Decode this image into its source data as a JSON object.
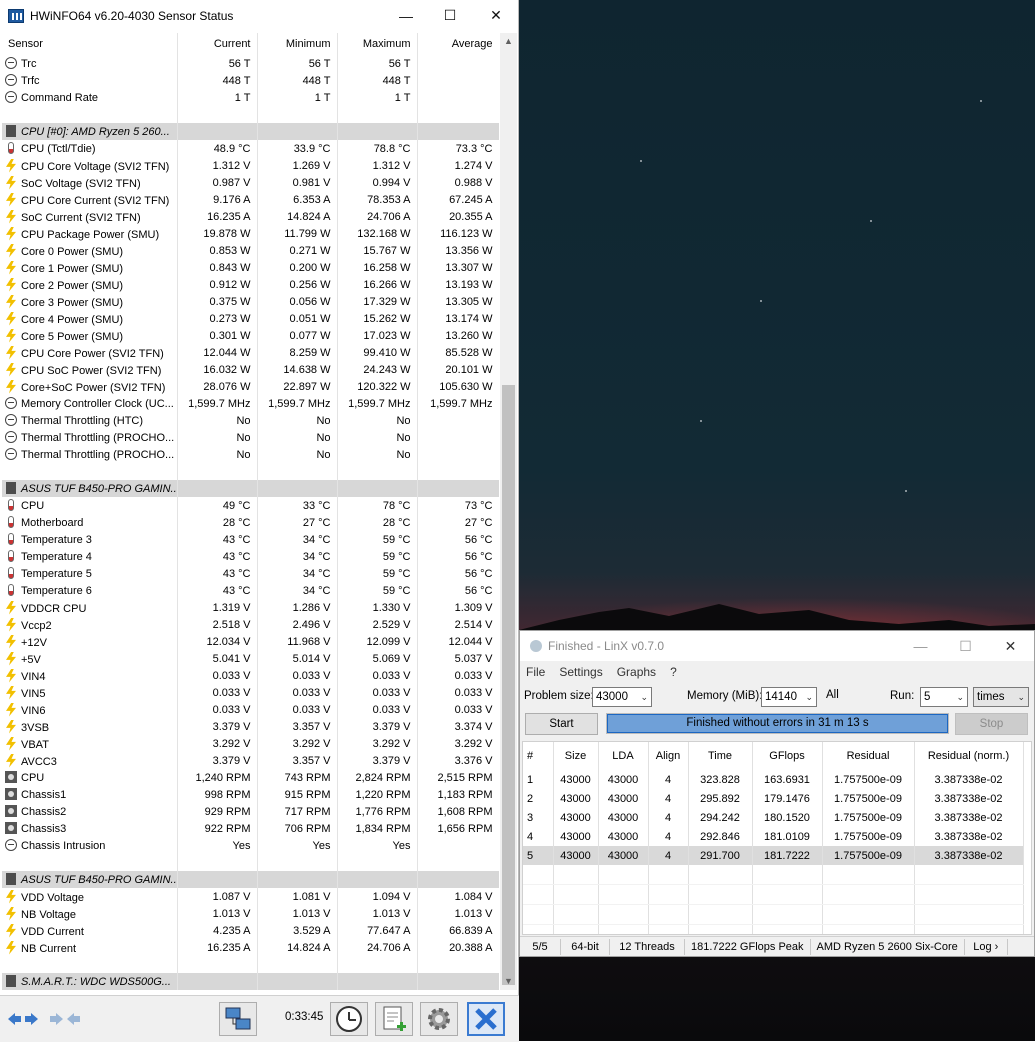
{
  "hwinfo": {
    "title": "HWiNFO64 v6.20-4030 Sensor Status",
    "columns": [
      "Sensor",
      "Current",
      "Minimum",
      "Maximum",
      "Average"
    ],
    "rows": [
      {
        "type": "row",
        "icon": "dash",
        "name": "Trc",
        "cur": "56 T",
        "min": "56 T",
        "max": "56 T",
        "avg": ""
      },
      {
        "type": "row",
        "icon": "dash",
        "name": "Trfc",
        "cur": "448 T",
        "min": "448 T",
        "max": "448 T",
        "avg": ""
      },
      {
        "type": "row",
        "icon": "dash",
        "name": "Command Rate",
        "cur": "1 T",
        "min": "1 T",
        "max": "1 T",
        "avg": ""
      },
      {
        "type": "blank"
      },
      {
        "type": "group",
        "name": "CPU [#0]: AMD Ryzen 5 260..."
      },
      {
        "type": "row",
        "icon": "temp",
        "name": "CPU (Tctl/Tdie)",
        "cur": "48.9 °C",
        "min": "33.9 °C",
        "max": "78.8 °C",
        "avg": "73.3 °C"
      },
      {
        "type": "row",
        "icon": "volt",
        "name": "CPU Core Voltage (SVI2 TFN)",
        "cur": "1.312 V",
        "min": "1.269 V",
        "max": "1.312 V",
        "avg": "1.274 V"
      },
      {
        "type": "row",
        "icon": "volt",
        "name": "SoC Voltage (SVI2 TFN)",
        "cur": "0.987 V",
        "min": "0.981 V",
        "max": "0.994 V",
        "avg": "0.988 V"
      },
      {
        "type": "row",
        "icon": "volt",
        "name": "CPU Core Current (SVI2 TFN)",
        "cur": "9.176 A",
        "min": "6.353 A",
        "max": "78.353 A",
        "avg": "67.245 A"
      },
      {
        "type": "row",
        "icon": "volt",
        "name": "SoC Current (SVI2 TFN)",
        "cur": "16.235 A",
        "min": "14.824 A",
        "max": "24.706 A",
        "avg": "20.355 A"
      },
      {
        "type": "row",
        "icon": "volt",
        "name": "CPU Package Power (SMU)",
        "cur": "19.878 W",
        "min": "11.799 W",
        "max": "132.168 W",
        "avg": "116.123 W"
      },
      {
        "type": "row",
        "icon": "volt",
        "name": "Core 0 Power (SMU)",
        "cur": "0.853 W",
        "min": "0.271 W",
        "max": "15.767 W",
        "avg": "13.356 W"
      },
      {
        "type": "row",
        "icon": "volt",
        "name": "Core 1 Power (SMU)",
        "cur": "0.843 W",
        "min": "0.200 W",
        "max": "16.258 W",
        "avg": "13.307 W"
      },
      {
        "type": "row",
        "icon": "volt",
        "name": "Core 2 Power (SMU)",
        "cur": "0.912 W",
        "min": "0.256 W",
        "max": "16.266 W",
        "avg": "13.193 W"
      },
      {
        "type": "row",
        "icon": "volt",
        "name": "Core 3 Power (SMU)",
        "cur": "0.375 W",
        "min": "0.056 W",
        "max": "17.329 W",
        "avg": "13.305 W"
      },
      {
        "type": "row",
        "icon": "volt",
        "name": "Core 4 Power (SMU)",
        "cur": "0.273 W",
        "min": "0.051 W",
        "max": "15.262 W",
        "avg": "13.174 W"
      },
      {
        "type": "row",
        "icon": "volt",
        "name": "Core 5 Power (SMU)",
        "cur": "0.301 W",
        "min": "0.077 W",
        "max": "17.023 W",
        "avg": "13.260 W"
      },
      {
        "type": "row",
        "icon": "volt",
        "name": "CPU Core Power (SVI2 TFN)",
        "cur": "12.044 W",
        "min": "8.259 W",
        "max": "99.410 W",
        "avg": "85.528 W"
      },
      {
        "type": "row",
        "icon": "volt",
        "name": "CPU SoC Power (SVI2 TFN)",
        "cur": "16.032 W",
        "min": "14.638 W",
        "max": "24.243 W",
        "avg": "20.101 W"
      },
      {
        "type": "row",
        "icon": "volt",
        "name": "Core+SoC Power (SVI2 TFN)",
        "cur": "28.076 W",
        "min": "22.897 W",
        "max": "120.322 W",
        "avg": "105.630 W"
      },
      {
        "type": "row",
        "icon": "dash",
        "name": "Memory Controller Clock (UC...",
        "cur": "1,599.7 MHz",
        "min": "1,599.7 MHz",
        "max": "1,599.7 MHz",
        "avg": "1,599.7 MHz"
      },
      {
        "type": "row",
        "icon": "dash",
        "name": "Thermal Throttling (HTC)",
        "cur": "No",
        "min": "No",
        "max": "No",
        "avg": ""
      },
      {
        "type": "row",
        "icon": "dash",
        "name": "Thermal Throttling (PROCHO...",
        "cur": "No",
        "min": "No",
        "max": "No",
        "avg": ""
      },
      {
        "type": "row",
        "icon": "dash",
        "name": "Thermal Throttling (PROCHO...",
        "cur": "No",
        "min": "No",
        "max": "No",
        "avg": ""
      },
      {
        "type": "blank"
      },
      {
        "type": "group",
        "name": "ASUS TUF B450-PRO GAMIN..."
      },
      {
        "type": "row",
        "icon": "temp",
        "name": "CPU",
        "cur": "49 °C",
        "min": "33 °C",
        "max": "78 °C",
        "avg": "73 °C"
      },
      {
        "type": "row",
        "icon": "temp",
        "name": "Motherboard",
        "cur": "28 °C",
        "min": "27 °C",
        "max": "28 °C",
        "avg": "27 °C"
      },
      {
        "type": "row",
        "icon": "temp",
        "name": "Temperature 3",
        "cur": "43 °C",
        "min": "34 °C",
        "max": "59 °C",
        "avg": "56 °C"
      },
      {
        "type": "row",
        "icon": "temp",
        "name": "Temperature 4",
        "cur": "43 °C",
        "min": "34 °C",
        "max": "59 °C",
        "avg": "56 °C"
      },
      {
        "type": "row",
        "icon": "temp",
        "name": "Temperature 5",
        "cur": "43 °C",
        "min": "34 °C",
        "max": "59 °C",
        "avg": "56 °C"
      },
      {
        "type": "row",
        "icon": "temp",
        "name": "Temperature 6",
        "cur": "43 °C",
        "min": "34 °C",
        "max": "59 °C",
        "avg": "56 °C"
      },
      {
        "type": "row",
        "icon": "volt",
        "name": "VDDCR CPU",
        "cur": "1.319 V",
        "min": "1.286 V",
        "max": "1.330 V",
        "avg": "1.309 V"
      },
      {
        "type": "row",
        "icon": "volt",
        "name": "Vccp2",
        "cur": "2.518 V",
        "min": "2.496 V",
        "max": "2.529 V",
        "avg": "2.514 V"
      },
      {
        "type": "row",
        "icon": "volt",
        "name": "+12V",
        "cur": "12.034 V",
        "min": "11.968 V",
        "max": "12.099 V",
        "avg": "12.044 V"
      },
      {
        "type": "row",
        "icon": "volt",
        "name": "+5V",
        "cur": "5.041 V",
        "min": "5.014 V",
        "max": "5.069 V",
        "avg": "5.037 V"
      },
      {
        "type": "row",
        "icon": "volt",
        "name": "VIN4",
        "cur": "0.033 V",
        "min": "0.033 V",
        "max": "0.033 V",
        "avg": "0.033 V"
      },
      {
        "type": "row",
        "icon": "volt",
        "name": "VIN5",
        "cur": "0.033 V",
        "min": "0.033 V",
        "max": "0.033 V",
        "avg": "0.033 V"
      },
      {
        "type": "row",
        "icon": "volt",
        "name": "VIN6",
        "cur": "0.033 V",
        "min": "0.033 V",
        "max": "0.033 V",
        "avg": "0.033 V"
      },
      {
        "type": "row",
        "icon": "volt",
        "name": "3VSB",
        "cur": "3.379 V",
        "min": "3.357 V",
        "max": "3.379 V",
        "avg": "3.374 V"
      },
      {
        "type": "row",
        "icon": "volt",
        "name": "VBAT",
        "cur": "3.292 V",
        "min": "3.292 V",
        "max": "3.292 V",
        "avg": "3.292 V"
      },
      {
        "type": "row",
        "icon": "volt",
        "name": "AVCC3",
        "cur": "3.379 V",
        "min": "3.357 V",
        "max": "3.379 V",
        "avg": "3.376 V"
      },
      {
        "type": "row",
        "icon": "fan",
        "name": "CPU",
        "cur": "1,240 RPM",
        "min": "743 RPM",
        "max": "2,824 RPM",
        "avg": "2,515 RPM"
      },
      {
        "type": "row",
        "icon": "fan",
        "name": "Chassis1",
        "cur": "998 RPM",
        "min": "915 RPM",
        "max": "1,220 RPM",
        "avg": "1,183 RPM"
      },
      {
        "type": "row",
        "icon": "fan",
        "name": "Chassis2",
        "cur": "929 RPM",
        "min": "717 RPM",
        "max": "1,776 RPM",
        "avg": "1,608 RPM"
      },
      {
        "type": "row",
        "icon": "fan",
        "name": "Chassis3",
        "cur": "922 RPM",
        "min": "706 RPM",
        "max": "1,834 RPM",
        "avg": "1,656 RPM"
      },
      {
        "type": "row",
        "icon": "dash",
        "name": "Chassis Intrusion",
        "cur": "Yes",
        "min": "Yes",
        "max": "Yes",
        "avg": ""
      },
      {
        "type": "blank"
      },
      {
        "type": "group",
        "name": "ASUS TUF B450-PRO GAMIN..."
      },
      {
        "type": "row",
        "icon": "volt",
        "name": "VDD Voltage",
        "cur": "1.087 V",
        "min": "1.081 V",
        "max": "1.094 V",
        "avg": "1.084 V"
      },
      {
        "type": "row",
        "icon": "volt",
        "name": "NB Voltage",
        "cur": "1.013 V",
        "min": "1.013 V",
        "max": "1.013 V",
        "avg": "1.013 V"
      },
      {
        "type": "row",
        "icon": "volt",
        "name": "VDD Current",
        "cur": "4.235 A",
        "min": "3.529 A",
        "max": "77.647 A",
        "avg": "66.839 A"
      },
      {
        "type": "row",
        "icon": "volt",
        "name": "NB Current",
        "cur": "16.235 A",
        "min": "14.824 A",
        "max": "24.706 A",
        "avg": "20.388 A"
      },
      {
        "type": "blank"
      },
      {
        "type": "group",
        "name": "S.M.A.R.T.: WDC WDS500G..."
      }
    ],
    "elapsed": "0:33:45"
  },
  "linx": {
    "title": "Finished - LinX v0.7.0",
    "menu": [
      "File",
      "Settings",
      "Graphs",
      "?"
    ],
    "problem_size_label": "Problem size:",
    "problem_size": "43000",
    "memory_label": "Memory (MiB):",
    "memory": "14140",
    "all_label": "All",
    "run_label": "Run:",
    "run": "5",
    "run_unit": "times",
    "start_label": "Start",
    "stop_label": "Stop",
    "progress_fraction": 1.0,
    "progress_text": "Finished without errors in 31 m 13 s",
    "columns": [
      "#",
      "Size",
      "LDA",
      "Align",
      "Time",
      "GFlops",
      "Residual",
      "Residual (norm.)"
    ],
    "results": [
      [
        "1",
        "43000",
        "43000",
        "4",
        "323.828",
        "163.6931",
        "1.757500e-09",
        "3.387338e-02"
      ],
      [
        "2",
        "43000",
        "43000",
        "4",
        "295.892",
        "179.1476",
        "1.757500e-09",
        "3.387338e-02"
      ],
      [
        "3",
        "43000",
        "43000",
        "4",
        "294.242",
        "180.1520",
        "1.757500e-09",
        "3.387338e-02"
      ],
      [
        "4",
        "43000",
        "43000",
        "4",
        "292.846",
        "181.0109",
        "1.757500e-09",
        "3.387338e-02"
      ],
      [
        "5",
        "43000",
        "43000",
        "4",
        "291.700",
        "181.7222",
        "1.757500e-09",
        "3.387338e-02"
      ]
    ],
    "selected_row": 4,
    "status": [
      "5/5",
      "64-bit",
      "12 Threads",
      "181.7222 GFlops Peak",
      "AMD Ryzen 5 2600 Six-Core",
      "Log ›"
    ]
  }
}
